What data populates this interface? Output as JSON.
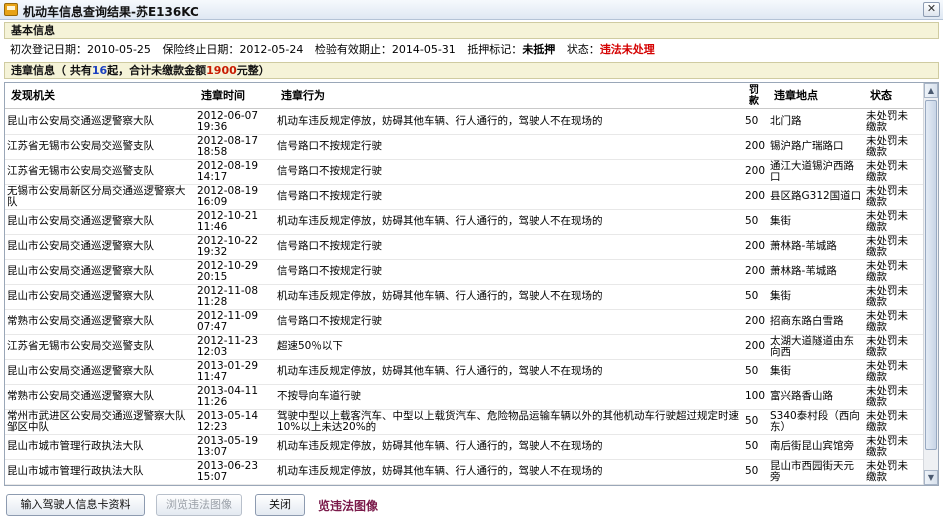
{
  "window": {
    "title": "机动车信息查询结果-苏E136KC",
    "close_glyph": "✕"
  },
  "basic": {
    "header": "基本信息",
    "first_reg_label": "初次登记日期：",
    "first_reg_value": "2010-05-25",
    "insurance_label": "保险终止日期：",
    "insurance_value": "2012-05-24",
    "inspection_label": "检验有效期止：",
    "inspection_value": "2014-05-31",
    "mortgage_label": "抵押标记：",
    "mortgage_value": "未抵押",
    "status_label": "状态：",
    "status_value": "违法未处理"
  },
  "violation_summary": {
    "prefix": "违章信息（ 共有",
    "count": "16",
    "middle": "起，合计未缴款金额",
    "amount": "1900",
    "suffix": "元整）"
  },
  "table": {
    "headers": {
      "org": "发现机关",
      "time": "违章时间",
      "act": "违章行为",
      "fine": "罚款",
      "place": "违章地点",
      "status": "状态"
    },
    "rows": [
      {
        "org": "昆山市公安局交通巡逻警察大队",
        "time": "2012-06-07 19:36",
        "act": "机动车违反规定停放，妨碍其他车辆、行人通行的，驾驶人不在现场的",
        "fine": "50",
        "place": "北门路",
        "status": "未处罚未缴款"
      },
      {
        "org": "江苏省无锡市公安局交巡警支队",
        "time": "2012-08-17 18:58",
        "act": "信号路口不按规定行驶",
        "fine": "200",
        "place": "锡沪路广瑞路口",
        "status": "未处罚未缴款"
      },
      {
        "org": "江苏省无锡市公安局交巡警支队",
        "time": "2012-08-19 14:17",
        "act": "信号路口不按规定行驶",
        "fine": "200",
        "place": "通江大道锡沪西路口",
        "status": "未处罚未缴款"
      },
      {
        "org": "无锡市公安局新区分局交通巡逻警察大队",
        "time": "2012-08-19 16:09",
        "act": "信号路口不按规定行驶",
        "fine": "200",
        "place": "县区路G312国道口",
        "status": "未处罚未缴款"
      },
      {
        "org": "昆山市公安局交通巡逻警察大队",
        "time": "2012-10-21 11:46",
        "act": "机动车违反规定停放，妨碍其他车辆、行人通行的，驾驶人不在现场的",
        "fine": "50",
        "place": "集街",
        "status": "未处罚未缴款"
      },
      {
        "org": "昆山市公安局交通巡逻警察大队",
        "time": "2012-10-22 19:32",
        "act": "信号路口不按规定行驶",
        "fine": "200",
        "place": "萧林路-苇城路",
        "status": "未处罚未缴款"
      },
      {
        "org": "昆山市公安局交通巡逻警察大队",
        "time": "2012-10-29 20:15",
        "act": "信号路口不按规定行驶",
        "fine": "200",
        "place": "萧林路-苇城路",
        "status": "未处罚未缴款"
      },
      {
        "org": "昆山市公安局交通巡逻警察大队",
        "time": "2012-11-08 11:28",
        "act": "机动车违反规定停放，妨碍其他车辆、行人通行的，驾驶人不在现场的",
        "fine": "50",
        "place": "集街",
        "status": "未处罚未缴款"
      },
      {
        "org": "常熟市公安局交通巡逻警察大队",
        "time": "2012-11-09 07:47",
        "act": "信号路口不按规定行驶",
        "fine": "200",
        "place": "招商东路白雪路",
        "status": "未处罚未缴款"
      },
      {
        "org": "江苏省无锡市公安局交巡警支队",
        "time": "2012-11-23 12:03",
        "act": "超速50％以下",
        "fine": "200",
        "place": "太湖大道隧道由东向西",
        "status": "未处罚未缴款"
      },
      {
        "org": "昆山市公安局交通巡逻警察大队",
        "time": "2013-01-29 11:47",
        "act": "机动车违反规定停放，妨碍其他车辆、行人通行的，驾驶人不在现场的",
        "fine": "50",
        "place": "集街",
        "status": "未处罚未缴款"
      },
      {
        "org": "常熟市公安局交通巡逻警察大队",
        "time": "2013-04-11 11:26",
        "act": "不按导向车道行驶",
        "fine": "100",
        "place": "富兴路香山路",
        "status": "未处罚未缴款"
      },
      {
        "org": "常州市武进区公安局交通巡逻警察大队邹区中队",
        "time": "2013-05-14 12:23",
        "act": "驾驶中型以上载客汽车、中型以上载货汽车、危险物品运输车辆以外的其他机动车行驶超过规定时速10%以上未达20%的",
        "fine": "50",
        "place": "S340泰村段（西向东）",
        "status": "未处罚未缴款"
      },
      {
        "org": "昆山市城市管理行政执法大队",
        "time": "2013-05-19 13:07",
        "act": "机动车违反规定停放，妨碍其他车辆、行人通行的，驾驶人不在现场的",
        "fine": "50",
        "place": "南后街昆山宾馆旁",
        "status": "未处罚未缴款"
      },
      {
        "org": "昆山市城市管理行政执法大队",
        "time": "2013-06-23 15:07",
        "act": "机动车违反规定停放，妨碍其他车辆、行人通行的，驾驶人不在现场的",
        "fine": "50",
        "place": "昆山市西园街天元旁",
        "status": "未处罚未缴款"
      }
    ]
  },
  "scrollbar": {
    "up_glyph": "▲",
    "down_glyph": "▼"
  },
  "buttons": {
    "input_label": "输入驾驶人信息卡资料",
    "browse_label": "浏览违法图像",
    "close_label": "关闭",
    "view_link": "览违法图像"
  }
}
